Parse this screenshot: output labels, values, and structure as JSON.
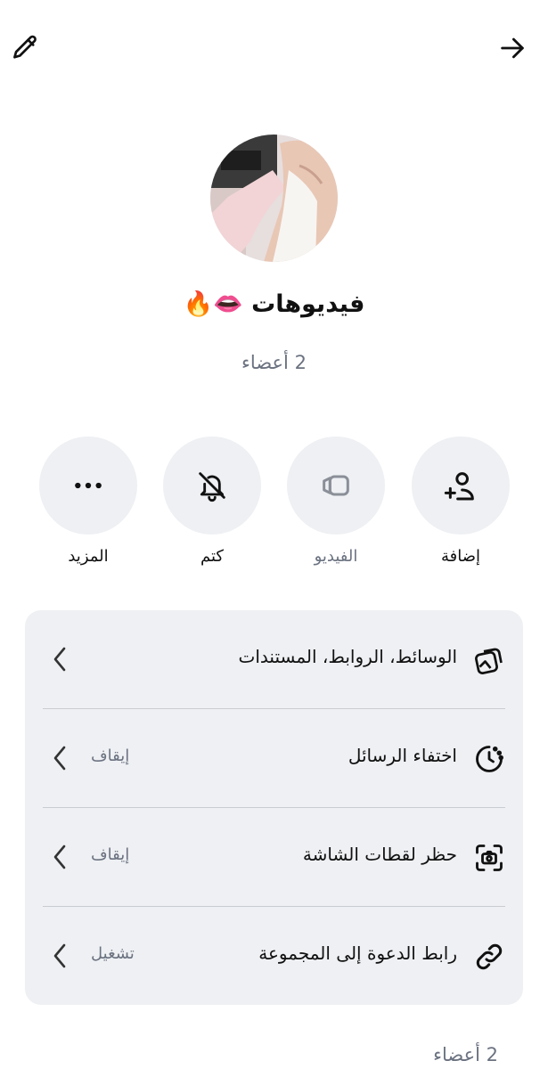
{
  "header": {
    "edit_icon": "pencil-icon",
    "back_icon": "arrow-right-icon"
  },
  "group": {
    "name": "فيديوهات 👄🔥",
    "members_count": "2 أعضاء"
  },
  "actions": [
    {
      "label": "إضافة",
      "icon": "add-user-icon",
      "enabled": true
    },
    {
      "label": "الفيديو",
      "icon": "video-icon",
      "enabled": false
    },
    {
      "label": "كتم",
      "icon": "bell-off-icon",
      "enabled": true
    },
    {
      "label": "المزيد",
      "icon": "more-icon",
      "enabled": true
    }
  ],
  "settings": [
    {
      "label": "الوسائط، الروابط، المستندات",
      "status": "",
      "icon": "media-icon"
    },
    {
      "label": "اختفاء الرسائل",
      "status": "إيقاف",
      "icon": "timer-icon"
    },
    {
      "label": "حظر لقطات الشاشة",
      "status": "إيقاف",
      "icon": "screenshot-icon"
    },
    {
      "label": "رابط الدعوة إلى المجموعة",
      "status": "تشغيل",
      "icon": "link-icon"
    }
  ],
  "footer": {
    "members_count": "2 أعضاء"
  },
  "colors": {
    "background": "#ffffff",
    "card": "#eef0f3",
    "muted_text": "#6b7280",
    "text": "#111111"
  }
}
